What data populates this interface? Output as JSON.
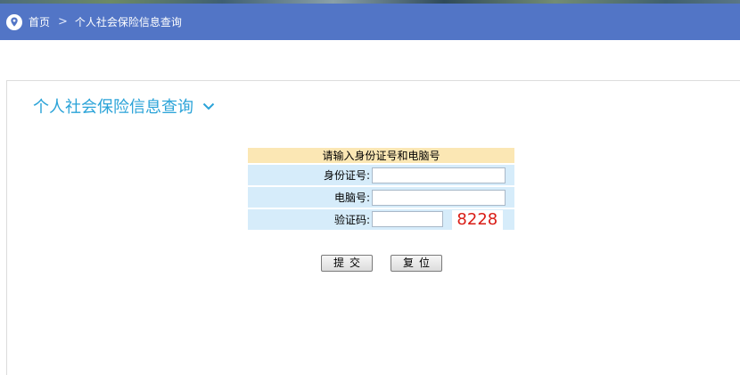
{
  "breadcrumb": {
    "home": "首页",
    "separator": ">",
    "current": "个人社会保险信息查询"
  },
  "section": {
    "title": "个人社会保险信息查询"
  },
  "form": {
    "header": "请输入身份证号和电脑号",
    "id_label": "身份证号:",
    "id_value": "",
    "computer_label": "电脑号:",
    "computer_value": "",
    "captcha_label": "验证码:",
    "captcha_value": "",
    "captcha_code": "8228"
  },
  "buttons": {
    "submit": "提交",
    "reset": "复位"
  },
  "colors": {
    "navbar": "#5275c6",
    "title": "#2aa3d8",
    "captcha": "#d91b14"
  }
}
